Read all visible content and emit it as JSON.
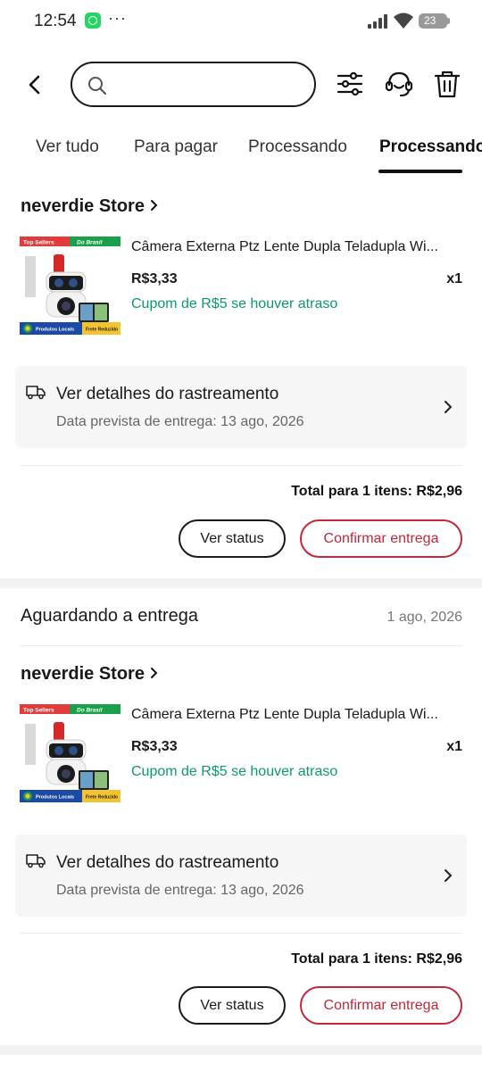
{
  "status_bar": {
    "time": "12:54",
    "dots": "···",
    "battery": "23"
  },
  "search": {
    "placeholder": ""
  },
  "tabs": [
    {
      "label": "Ver tudo"
    },
    {
      "label": "Para pagar"
    },
    {
      "label": "Processando"
    },
    {
      "label": "Processando"
    }
  ],
  "orders": [
    {
      "store": "neverdie Store",
      "product_title": "Câmera Externa Ptz Lente Dupla Teladupla Wi...",
      "price": "R$3,33",
      "qty": "x1",
      "coupon": "Cupom de R$5 se houver atraso",
      "tracking_title": "Ver detalhes do rastreamento",
      "tracking_date": "Data prevista de entrega: 13 ago, 2026",
      "total": "Total para 1 itens: R$2,96",
      "btn_status": "Ver status",
      "btn_confirm": "Confirmar entrega",
      "badges": {
        "top": "Top Sellers",
        "brasil": "Do Brasil",
        "local": "Produtos Locais",
        "frete": "Frete Reduzido"
      }
    },
    {
      "status": "Aguardando a entrega",
      "date": "1 ago, 2026",
      "store": "neverdie Store",
      "product_title": "Câmera Externa Ptz Lente Dupla Teladupla Wi...",
      "price": "R$3,33",
      "qty": "x1",
      "coupon": "Cupom de R$5 se houver atraso",
      "tracking_title": "Ver detalhes do rastreamento",
      "tracking_date": "Data prevista de entrega: 13 ago, 2026",
      "total": "Total para 1 itens: R$2,96",
      "btn_status": "Ver status",
      "btn_confirm": "Confirmar entrega",
      "badges": {
        "top": "Top Sellers",
        "brasil": "Do Brasil",
        "local": "Produtos Locais",
        "frete": "Frete Reduzido"
      }
    }
  ],
  "colors": {
    "accent": "#c3283a",
    "coupon": "#0a9b6c",
    "separator": "#f2f2f2"
  }
}
